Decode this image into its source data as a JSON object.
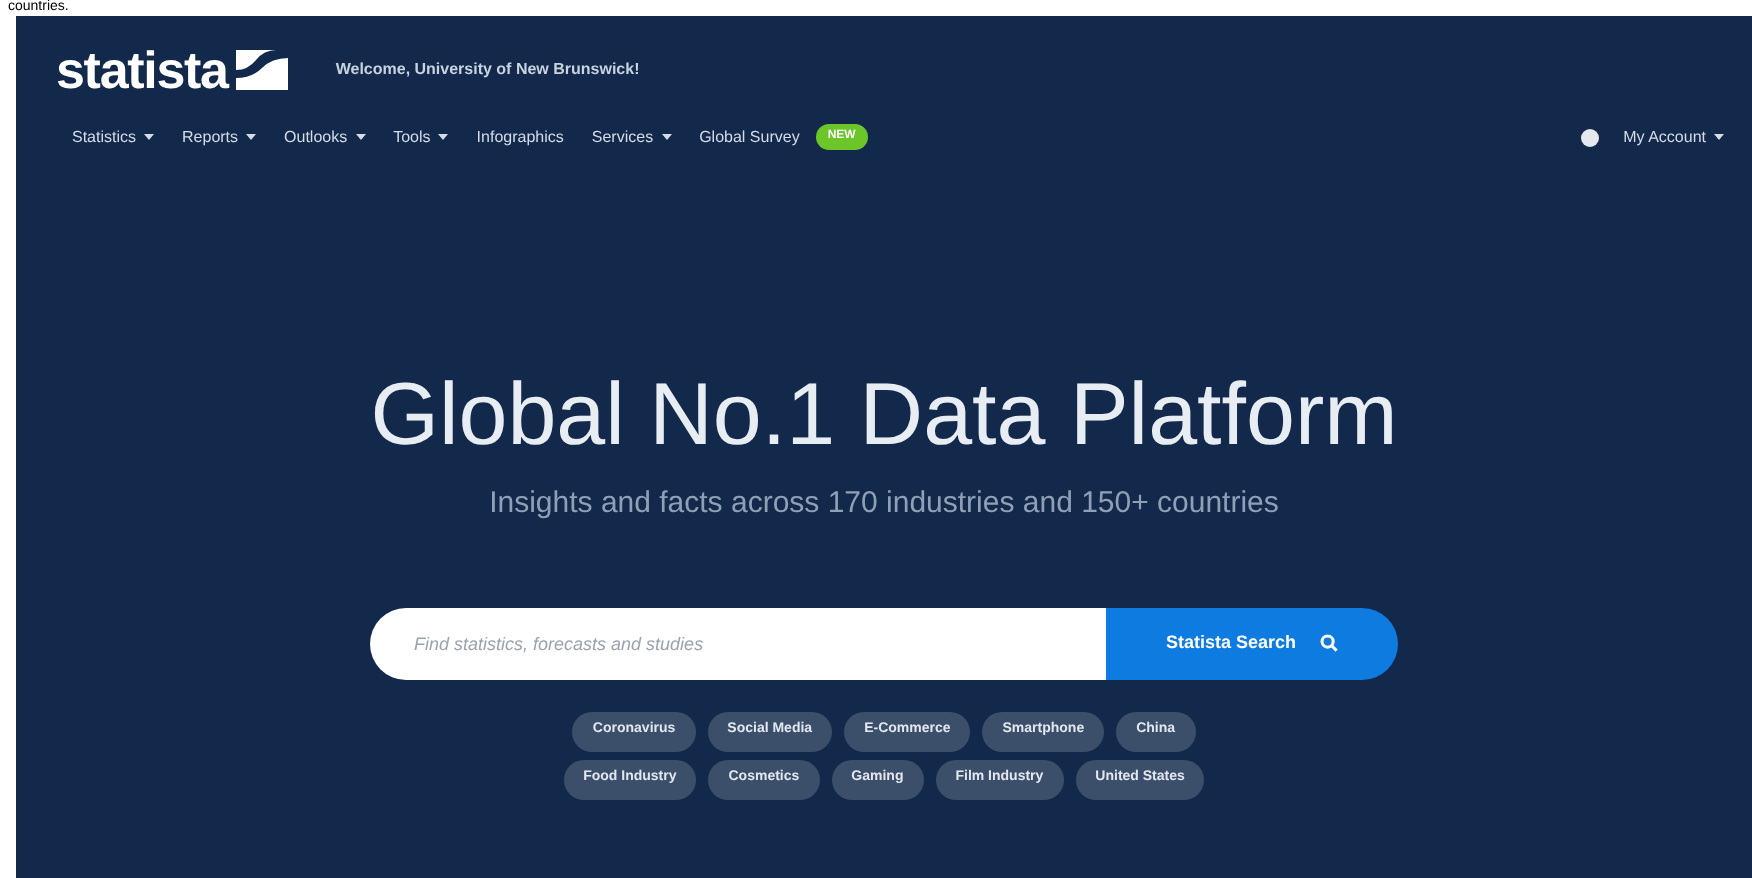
{
  "caption": "countries.",
  "header": {
    "logo": "statista",
    "welcome": "Welcome, University of New Brunswick!"
  },
  "nav": [
    {
      "label": "Statistics",
      "dropdown": true
    },
    {
      "label": "Reports",
      "dropdown": true
    },
    {
      "label": "Outlooks",
      "dropdown": true
    },
    {
      "label": "Tools",
      "dropdown": true
    },
    {
      "label": "Infographics",
      "dropdown": false
    },
    {
      "label": "Services",
      "dropdown": true
    },
    {
      "label": "Global Survey",
      "dropdown": false,
      "badge": "NEW"
    }
  ],
  "account": {
    "label": "My Account"
  },
  "hero": {
    "title": "Global No.1 Data Platform",
    "subtitle": "Insights and facts across 170 industries and 150+ countries"
  },
  "search": {
    "placeholder": "Find statistics, forecasts and studies",
    "button": "Statista Search"
  },
  "tags": [
    [
      "Coronavirus",
      "Social Media",
      "E-Commerce",
      "Smartphone",
      "China"
    ],
    [
      "Food Industry",
      "Cosmetics",
      "Gaming",
      "Film Industry",
      "United States"
    ]
  ]
}
